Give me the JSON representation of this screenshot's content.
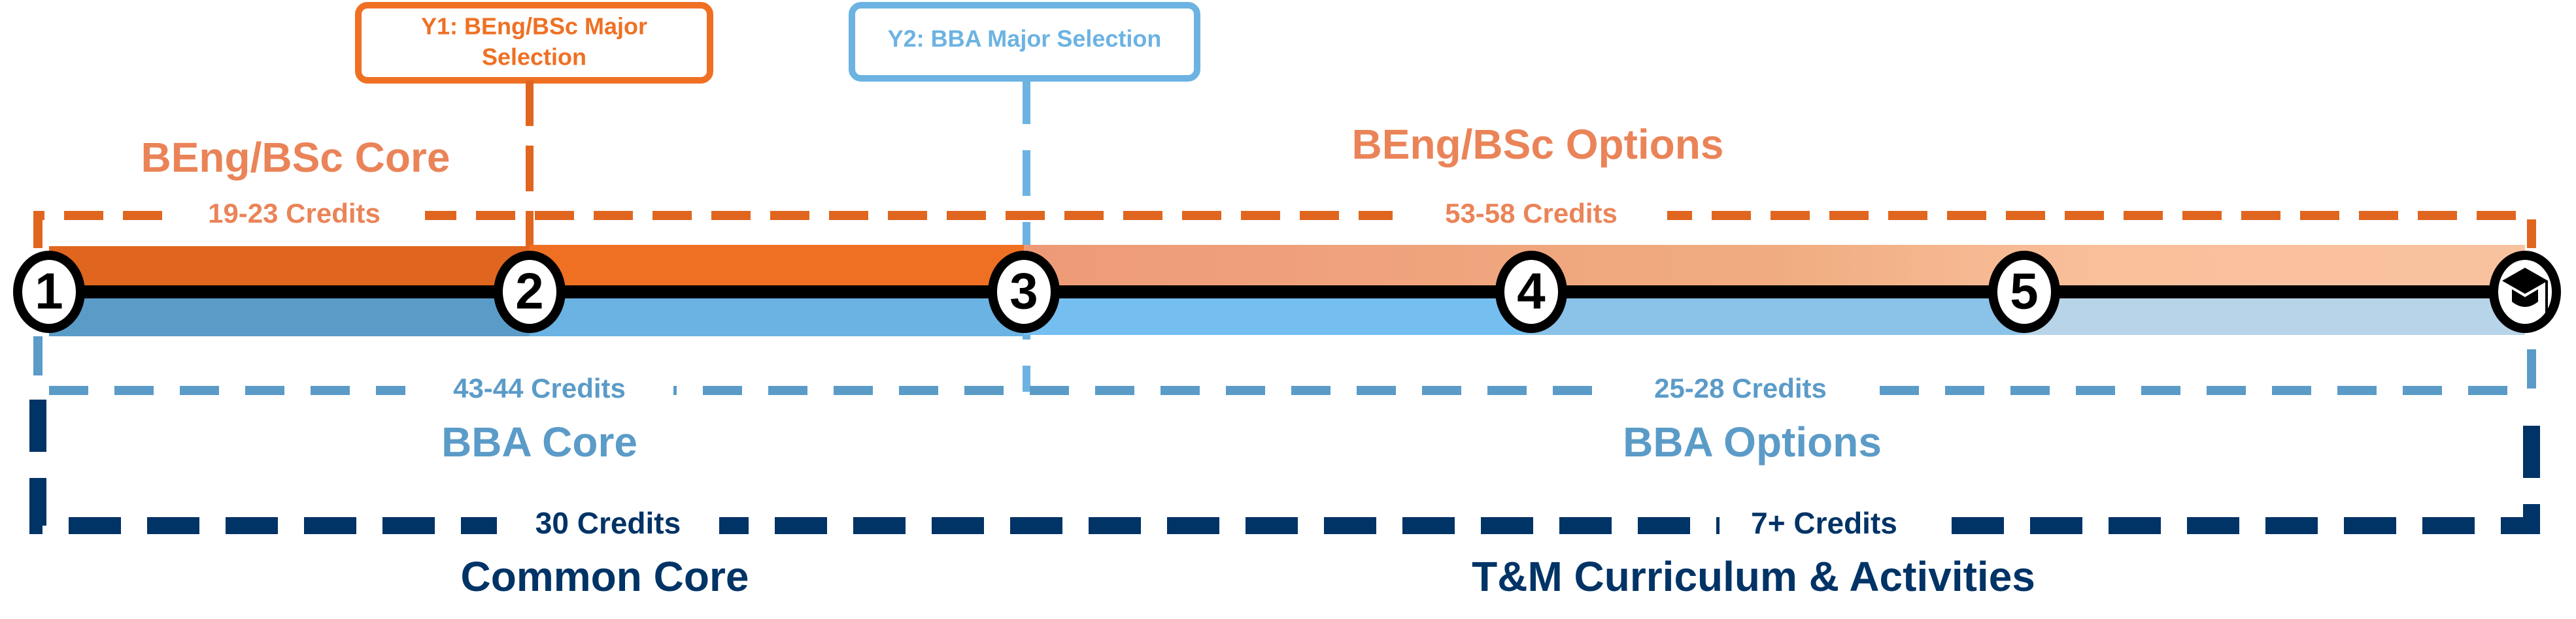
{
  "milestones": {
    "y1": {
      "label_line1": "Y1: BEng/BSc Major",
      "label_line2": "Selection"
    },
    "y2": {
      "label": "Y2: BBA Major Selection"
    }
  },
  "beng": {
    "core": {
      "title": "BEng/BSc Core",
      "credits": "19-23 Credits"
    },
    "options": {
      "title": "BEng/BSc Options",
      "credits": "53-58 Credits"
    }
  },
  "bba": {
    "core": {
      "title": "BBA Core",
      "credits": "43-44 Credits"
    },
    "options": {
      "title": "BBA Options",
      "credits": "25-28 Credits"
    }
  },
  "common": {
    "core": {
      "title": "Common Core",
      "credits": "30 Credits"
    },
    "tm": {
      "title": "T&M Curriculum & Activities",
      "credits": "7+ Credits"
    }
  },
  "nodes": [
    {
      "label": "1"
    },
    {
      "label": "2"
    },
    {
      "label": "3"
    },
    {
      "label": "4"
    },
    {
      "label": "5"
    },
    {
      "icon": "graduation-cap-icon"
    }
  ],
  "colors": {
    "orange_dark": "#E0661F",
    "orange": "#EF7023",
    "orange_text": "#EA8458",
    "blue": "#5B9BC8",
    "blue_light": "#6CB3E2",
    "navy": "#003366"
  }
}
